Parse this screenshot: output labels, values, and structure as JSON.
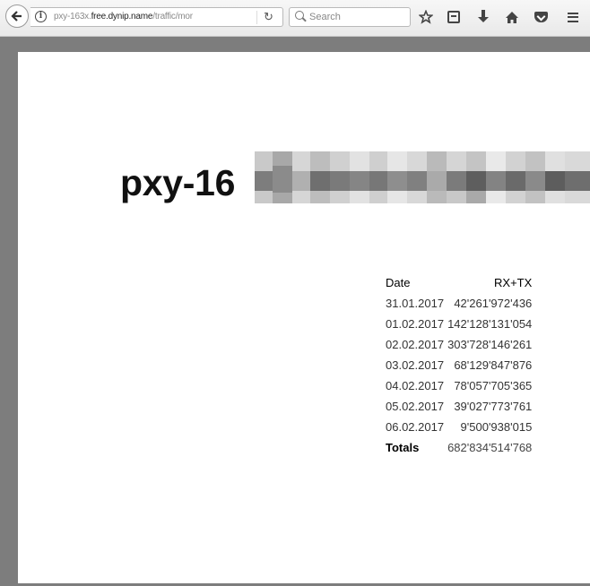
{
  "browser": {
    "url_prefix": "pxy-163x.",
    "url_domain": "free.dynip.name",
    "url_path": "/traffic/mor",
    "search_placeholder": "Search",
    "icons": [
      "back-arrow-icon",
      "info-icon",
      "reload-icon",
      "search-icon",
      "bookmark-star-icon",
      "library-icon",
      "download-icon",
      "home-icon",
      "pocket-icon",
      "menu-icon"
    ]
  },
  "page": {
    "host_title": "pxy-16",
    "table": {
      "headers": [
        "Date",
        "RX+TX"
      ],
      "rows": [
        [
          "31.01.2017",
          "42'261'972'436"
        ],
        [
          "01.02.2017",
          "142'128'131'054"
        ],
        [
          "02.02.2017",
          "303'728'146'261"
        ],
        [
          "03.02.2017",
          "68'129'847'876"
        ],
        [
          "04.02.2017",
          "78'057'705'365"
        ],
        [
          "05.02.2017",
          "39'027'773'761"
        ],
        [
          "06.02.2017",
          "9'500'938'015"
        ]
      ],
      "totals_label": "Totals",
      "totals_value": "682'834'514'768"
    }
  }
}
